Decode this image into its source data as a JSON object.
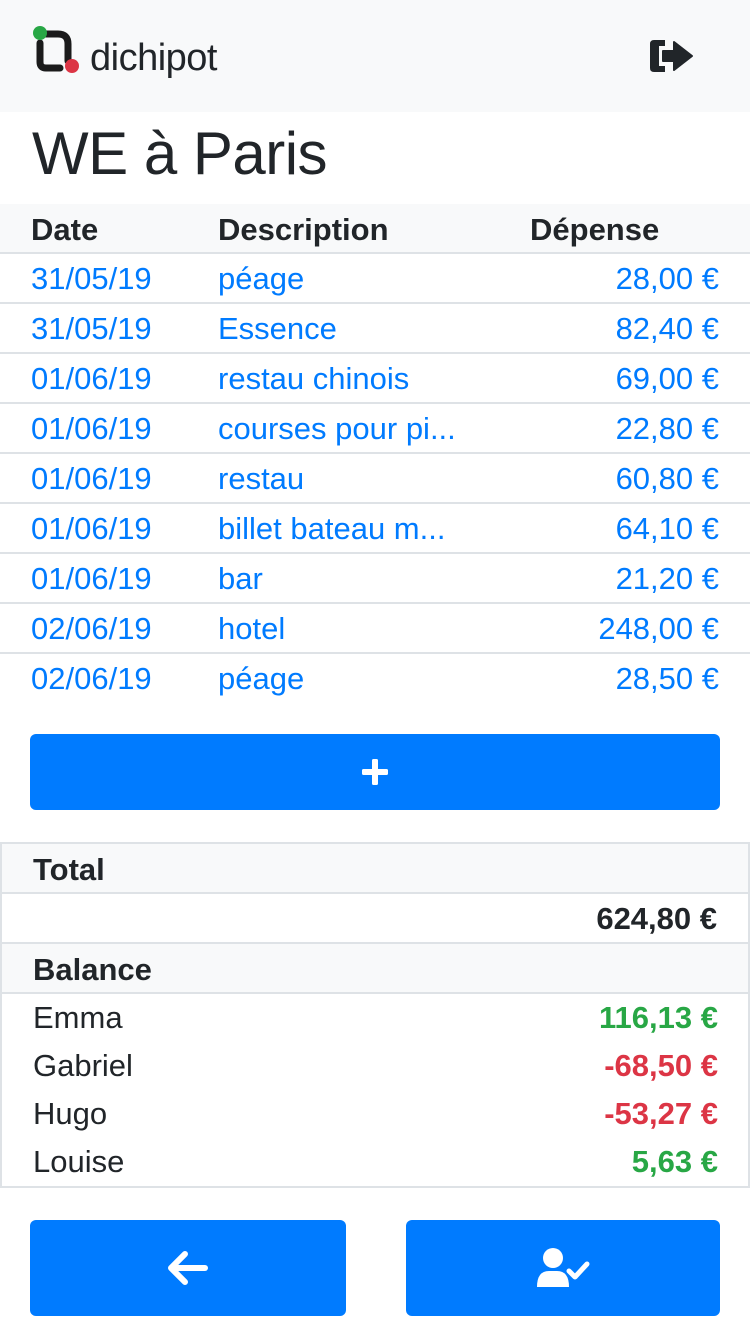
{
  "app": {
    "brand": "dichipot"
  },
  "page": {
    "title": "WE à Paris"
  },
  "expenses": {
    "headers": {
      "date": "Date",
      "description": "Description",
      "amount": "Dépense"
    },
    "rows": [
      {
        "date": "31/05/19",
        "description": "péage",
        "amount": "28,00 €"
      },
      {
        "date": "31/05/19",
        "description": "Essence",
        "amount": "82,40 €"
      },
      {
        "date": "01/06/19",
        "description": "restau chinois",
        "amount": "69,00 €"
      },
      {
        "date": "01/06/19",
        "description": "courses pour pi...",
        "amount": "22,80 €"
      },
      {
        "date": "01/06/19",
        "description": "restau",
        "amount": "60,80 €"
      },
      {
        "date": "01/06/19",
        "description": "billet bateau m...",
        "amount": "64,10 €"
      },
      {
        "date": "01/06/19",
        "description": "bar",
        "amount": "21,20 €"
      },
      {
        "date": "02/06/19",
        "description": "hotel",
        "amount": "248,00 €"
      },
      {
        "date": "02/06/19",
        "description": "péage",
        "amount": "28,50 €"
      }
    ]
  },
  "summary": {
    "total_label": "Total",
    "total_value": "624,80 €",
    "balance_label": "Balance",
    "balances": [
      {
        "name": "Emma",
        "amount": "116,13 €",
        "status": "positive"
      },
      {
        "name": "Gabriel",
        "amount": "-68,50 €",
        "status": "negative"
      },
      {
        "name": "Hugo",
        "amount": "-53,27 €",
        "status": "negative"
      },
      {
        "name": "Louise",
        "amount": "5,63 €",
        "status": "positive"
      }
    ]
  },
  "icons": {
    "logout": "sign-out-icon",
    "add": "plus-icon",
    "back": "arrow-left-icon",
    "settle": "user-check-icon"
  },
  "colors": {
    "primary": "#007bff",
    "positive": "#28a745",
    "negative": "#dc3545",
    "logo_green": "#28a745",
    "logo_red": "#dc3545"
  }
}
